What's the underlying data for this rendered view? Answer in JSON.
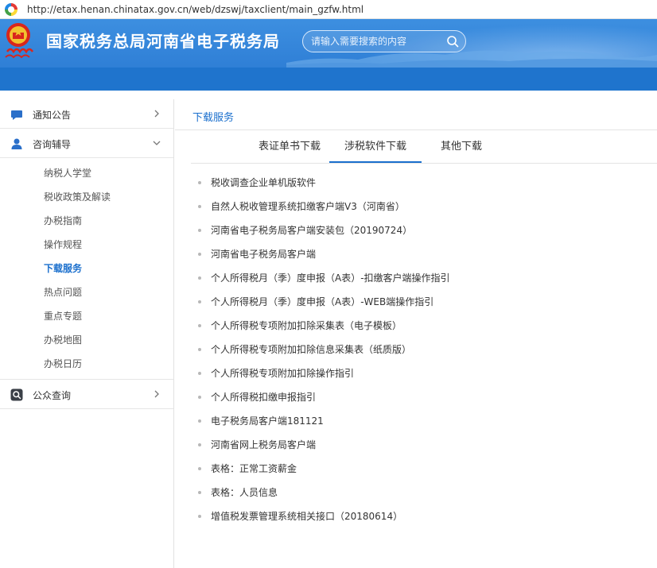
{
  "browser": {
    "url": "http://etax.henan.chinatax.gov.cn/web/dzswj/taxclient/main_gzfw.html"
  },
  "header": {
    "site_title": "国家税务总局河南省电子税务局",
    "search_placeholder": "请输入需要搜索的内容"
  },
  "colors": {
    "brand_blue": "#2f7fd6",
    "nav_blue": "#1f74cd",
    "active_text": "#1a6fcd"
  },
  "sidebar": {
    "groups": [
      {
        "label": "通知公告",
        "icon": "chat-bubble-icon",
        "expanded": false
      },
      {
        "label": "咨询辅导",
        "icon": "user-icon",
        "expanded": true,
        "items": [
          "纳税人学堂",
          "税收政策及解读",
          "办税指南",
          "操作规程",
          "下载服务",
          "热点问题",
          "重点专题",
          "办税地图",
          "办税日历"
        ],
        "active_item": "下载服务"
      },
      {
        "label": "公众查询",
        "icon": "search-box-icon",
        "expanded": false
      }
    ]
  },
  "main": {
    "title": "下载服务",
    "tabs": [
      {
        "label": "表证单书下载",
        "active": false
      },
      {
        "label": "涉税软件下载",
        "active": true
      },
      {
        "label": "其他下载",
        "active": false
      }
    ],
    "downloads": [
      "税收调查企业单机版软件",
      "自然人税收管理系统扣缴客户端V3（河南省）",
      "河南省电子税务局客户端安装包（20190724）",
      "河南省电子税务局客户端",
      "个人所得税月（季）度申报（A表）-扣缴客户端操作指引",
      "个人所得税月（季）度申报（A表）-WEB端操作指引",
      "个人所得税专项附加扣除采集表（电子模板）",
      "个人所得税专项附加扣除信息采集表（纸质版）",
      "个人所得税专项附加扣除操作指引",
      "个人所得税扣缴申报指引",
      "电子税务局客户端181121",
      "河南省网上税务局客户端",
      "表格：正常工资薪金",
      "表格：人员信息",
      "增值税发票管理系统相关接口（20180614）"
    ]
  }
}
